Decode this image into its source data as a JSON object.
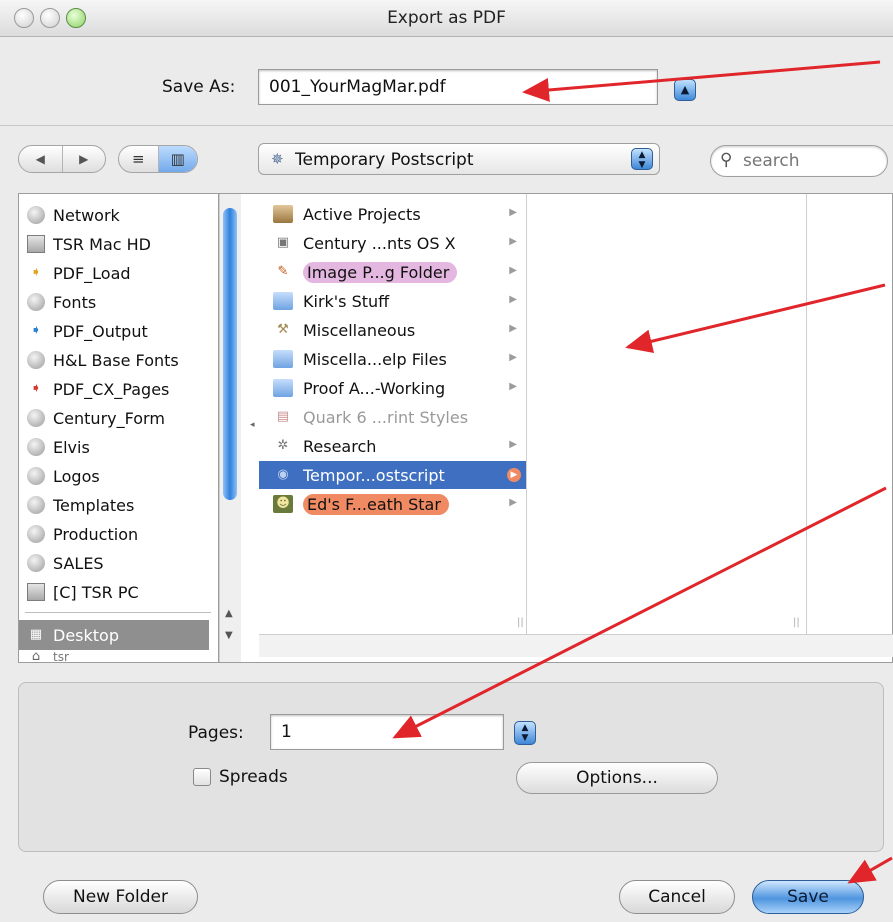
{
  "window": {
    "title": "Export as PDF"
  },
  "save_as": {
    "label": "Save As:",
    "value": "001_YourMagMar.pdf"
  },
  "toolbar": {
    "back_glyph": "◀",
    "forward_glyph": "▶",
    "list_view_glyph": "≡",
    "column_view_glyph": "▥",
    "location": "Temporary Postscript",
    "search_placeholder": "search"
  },
  "sidebar": {
    "items": [
      {
        "label": "Network",
        "icon": "network-icon"
      },
      {
        "label": "TSR Mac HD",
        "icon": "hard-drive-icon"
      },
      {
        "label": "PDF_Load",
        "icon": "shared-folder-icon"
      },
      {
        "label": "Fonts",
        "icon": "network-volume-icon"
      },
      {
        "label": "PDF_Output",
        "icon": "shared-folder-icon"
      },
      {
        "label": "H&L Base Fonts",
        "icon": "network-volume-icon"
      },
      {
        "label": "PDF_CX_Pages",
        "icon": "shared-folder-icon"
      },
      {
        "label": "Century_Form",
        "icon": "network-volume-icon"
      },
      {
        "label": "Elvis",
        "icon": "network-volume-icon"
      },
      {
        "label": "Logos",
        "icon": "network-volume-icon"
      },
      {
        "label": "Templates",
        "icon": "network-volume-icon"
      },
      {
        "label": "Production",
        "icon": "network-volume-icon"
      },
      {
        "label": "SALES",
        "icon": "network-volume-icon"
      },
      {
        "label": "[C] TSR PC",
        "icon": "pc-volume-icon"
      }
    ],
    "selected": "Desktop",
    "partial": "tsr"
  },
  "columns": {
    "first": [
      {
        "label": "Active Projects",
        "icon": "box-folder-icon"
      },
      {
        "label": "Century ...nts OS X",
        "icon": "app-folder-icon"
      },
      {
        "label": "Image P...g Folder",
        "icon": "script-icon",
        "tag": "purple"
      },
      {
        "label": "Kirk's Stuff",
        "icon": "folder-icon"
      },
      {
        "label": "Miscellaneous",
        "icon": "tools-folder-icon"
      },
      {
        "label": "Miscella...elp Files",
        "icon": "folder-icon"
      },
      {
        "label": "Proof A...-Working",
        "icon": "folder-icon"
      },
      {
        "label": "Quark 6 ...rint Styles",
        "icon": "document-icon",
        "dim": true
      },
      {
        "label": "Research",
        "icon": "research-icon"
      },
      {
        "label": "Tempor...ostscript",
        "icon": "volume-icon",
        "selected": true
      },
      {
        "label": "Ed's F...eath Star",
        "icon": "image-folder-icon",
        "tag": "orange"
      }
    ],
    "apple_glyph": ""
  },
  "options": {
    "pages_label": "Pages:",
    "pages_value": "1",
    "spreads_label": "Spreads",
    "options_button": "Options..."
  },
  "buttons": {
    "new_folder": "New Folder",
    "cancel": "Cancel",
    "save": "Save"
  },
  "colors": {
    "annotation_arrow": "#e0262b",
    "selection": "#3f6fc1",
    "aqua_blue": "#3f89d9"
  }
}
